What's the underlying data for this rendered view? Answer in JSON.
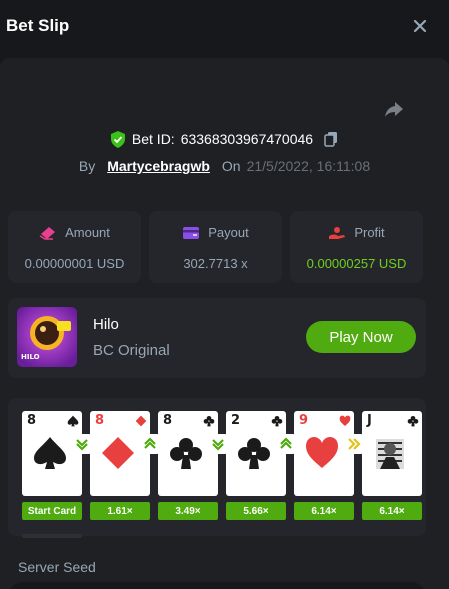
{
  "header": {
    "title": "Bet Slip"
  },
  "bet": {
    "bet_id_label": "Bet ID:",
    "bet_id": "63368303967470046",
    "by_label": "By",
    "user": "Martycebragwb",
    "on_label": "On",
    "date": "21/5/2022, 16:11:08"
  },
  "stats": {
    "amount": {
      "label": "Amount",
      "value": "0.00000001 USD"
    },
    "payout": {
      "label": "Payout",
      "value": "302.7713 x"
    },
    "profit": {
      "label": "Profit",
      "value": "0.00000257 USD"
    }
  },
  "game": {
    "name": "Hilo",
    "subtitle": "BC Original",
    "play_label": "Play Now",
    "thumb_text": "HILO"
  },
  "cards": [
    {
      "rank": "8",
      "suit": "spade",
      "color": "#1b1b1b",
      "multiplier": "Start Card"
    },
    {
      "rank": "8",
      "suit": "diamond",
      "color": "#e8403f",
      "multiplier": "1.61×"
    },
    {
      "rank": "8",
      "suit": "club",
      "color": "#1b1b1b",
      "multiplier": "3.49×"
    },
    {
      "rank": "2",
      "suit": "club",
      "color": "#1b1b1b",
      "multiplier": "5.66×"
    },
    {
      "rank": "9",
      "suit": "heart",
      "color": "#e8403f",
      "multiplier": "6.14×"
    },
    {
      "rank": "J",
      "suit": "club",
      "color": "#1b1b1b",
      "multiplier": "6.14×"
    }
  ],
  "arrows": [
    "lower",
    "higher",
    "lower",
    "higher",
    "skip"
  ],
  "seed": {
    "label": "Server Seed"
  },
  "colors": {
    "accent_green": "#4fab0f",
    "profit_green": "#6fcf1f",
    "background": "#17181b",
    "panel": "#1e2024",
    "card_bg": "#24262b"
  }
}
